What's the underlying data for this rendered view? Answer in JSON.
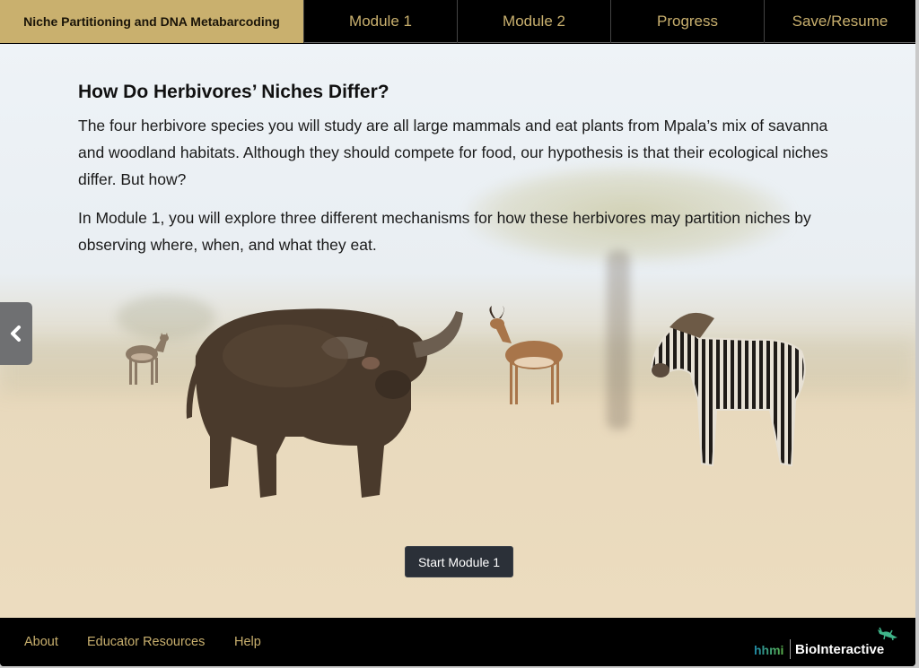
{
  "header": {
    "title": "Niche Partitioning and DNA Metabarcoding",
    "tabs": [
      {
        "label": "Module 1"
      },
      {
        "label": "Module 2"
      },
      {
        "label": "Progress"
      },
      {
        "label": "Save/Resume"
      }
    ]
  },
  "main": {
    "heading": "How Do Herbivores’ Niches Differ?",
    "paragraphs": [
      "The four herbivore species you will study are all large mammals and eat plants from Mpala’s mix of savanna and woodland habitats. Although they should compete for food, our hypothesis is that their ecological niches differ. But how?",
      "In Module 1, you will explore three different mechanisms for how these herbivores may partition niches by observing where, when, and what they eat."
    ],
    "animals": [
      "dik-dik",
      "buffalo",
      "impala",
      "zebra"
    ],
    "prev_icon": "chevron-left-icon",
    "start_button": "Start Module 1"
  },
  "footer": {
    "links": [
      {
        "label": "About"
      },
      {
        "label": "Educator Resources"
      },
      {
        "label": "Help"
      }
    ],
    "logo_left": "hhmi",
    "logo_right": "BioInteractive"
  },
  "colors": {
    "accent_gold": "#c9b06e",
    "nav_bg": "#000000",
    "button_dark": "#2b3038"
  }
}
